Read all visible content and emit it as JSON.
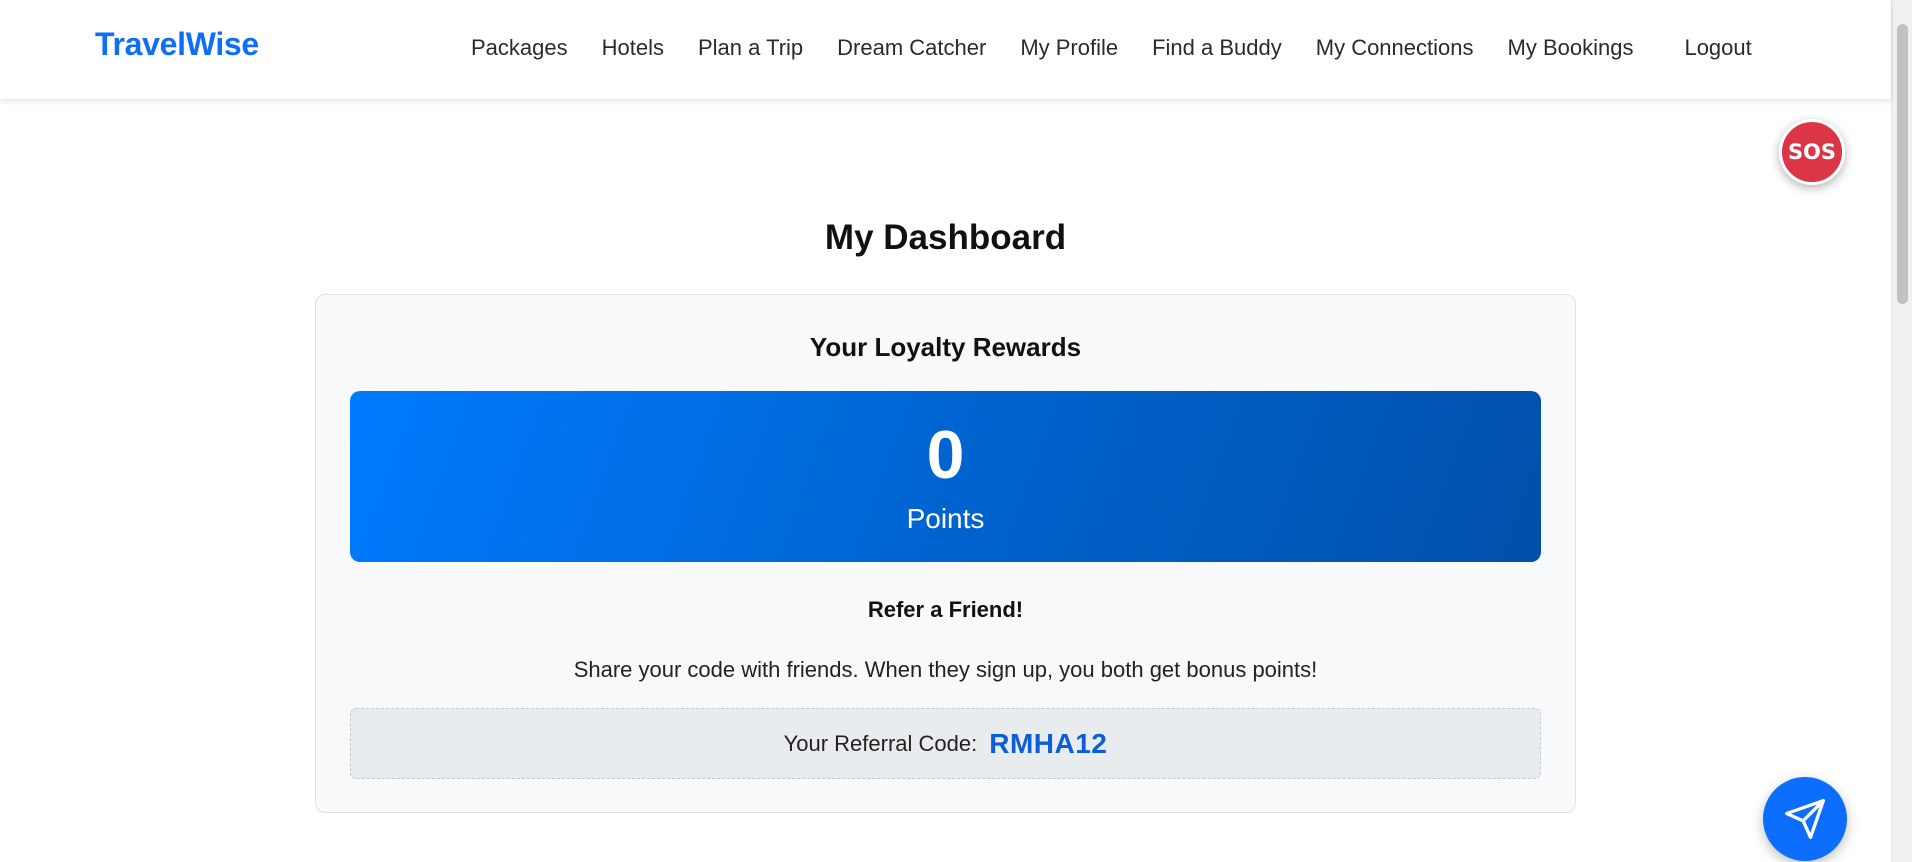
{
  "header": {
    "brand": "TravelWise",
    "nav": [
      {
        "label": "Packages"
      },
      {
        "label": "Hotels"
      },
      {
        "label": "Plan a Trip"
      },
      {
        "label": "Dream Catcher"
      },
      {
        "label": "My Profile"
      },
      {
        "label": "Find a Buddy"
      },
      {
        "label": "My Connections"
      },
      {
        "label": "My Bookings"
      }
    ],
    "logout": "Logout"
  },
  "sos": {
    "label": "SOS"
  },
  "dashboard": {
    "title": "My Dashboard",
    "loyalty": {
      "title": "Your Loyalty Rewards",
      "points_value": "0",
      "points_label": "Points"
    },
    "referral": {
      "title": "Refer a Friend!",
      "description": "Share your code with friends. When they sign up, you both get bonus points!",
      "code_label": "Your Referral Code:",
      "code": "RMHA12"
    }
  },
  "floating": {
    "send_icon": "paper-plane-icon"
  },
  "colors": {
    "brand": "#0d6efd",
    "sos": "#dc3545",
    "points_gradient_start": "#007bff",
    "points_gradient_end": "#0050aa",
    "code": "#0b5ed7"
  }
}
